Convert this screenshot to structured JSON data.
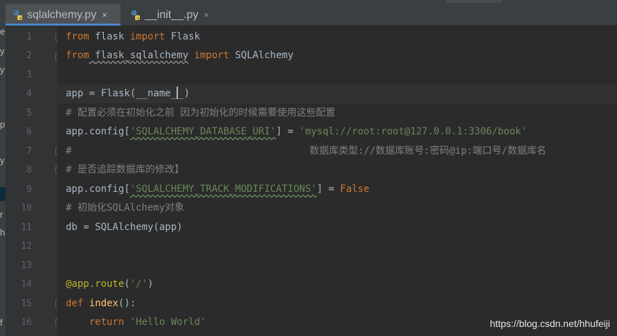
{
  "left_panel": {
    "fragments": [
      "e",
      "y",
      "y",
      "p",
      "y",
      "r",
      "h",
      "f"
    ],
    "selected": "y"
  },
  "tabs": [
    {
      "label": "sqlalchemy.py",
      "active": true,
      "close": "×"
    },
    {
      "label": "__init__.py",
      "active": false,
      "close": "×"
    }
  ],
  "line_numbers": [
    "1",
    "2",
    "3",
    "4",
    "5",
    "6",
    "7",
    "8",
    "9",
    "10",
    "11",
    "12",
    "13",
    "14",
    "15",
    "16"
  ],
  "code": {
    "l1": {
      "kw1": "from",
      "mod": " flask ",
      "kw2": "import",
      "name": " Flask"
    },
    "l2": {
      "kw1": "from",
      "sp": " ",
      "mod": "flask_sqlalchemy",
      "sp2": " ",
      "kw2": "import",
      "name": " SQLAlchemy"
    },
    "l4": {
      "pre": "app = Flask(__name_",
      "post": "_)"
    },
    "l5": {
      "comment": "# 配置必须在初始化之前 因为初始化的时候需要使用这些配置"
    },
    "l6": {
      "pre": "app.config[",
      "key": "'SQLALCHEMY_DATABASE_URI'",
      "mid": "] = ",
      "val": "'mysql://root:root@127.0.0.1:3306/book'"
    },
    "l7": {
      "hash": "#",
      "comment": "数据库类型://数据库账号:密码@ip:端口号/数据库名"
    },
    "l8": {
      "comment": "# 是否追踪数据库的修改】"
    },
    "l9": {
      "pre": "app.config[",
      "key": "'SQLALCHEMY_TRACK_MODIFICATIONS'",
      "mid": "] = ",
      "val": "False"
    },
    "l10": {
      "comment": "# 初始化SQLAlchemy对象"
    },
    "l11": {
      "text": "db = SQLAlchemy(app)"
    },
    "l14": {
      "dec": "@app.route",
      "open": "(",
      "str": "'/'",
      "close": ")"
    },
    "l15": {
      "kw": "def",
      "sp": " ",
      "fn": "index",
      "rest": "():"
    },
    "l16": {
      "indent": "    ",
      "kw": "return",
      "sp": " ",
      "str": "'Hello World'"
    }
  },
  "watermark": "https://blog.csdn.net/hhufeiji",
  "colors": {
    "background": "#2b2b2b",
    "keyword": "#cc7832",
    "string": "#6a8759",
    "comment": "#808080",
    "decorator": "#bbb529",
    "function": "#ffc66d",
    "tab_accent": "#4a88c7"
  }
}
